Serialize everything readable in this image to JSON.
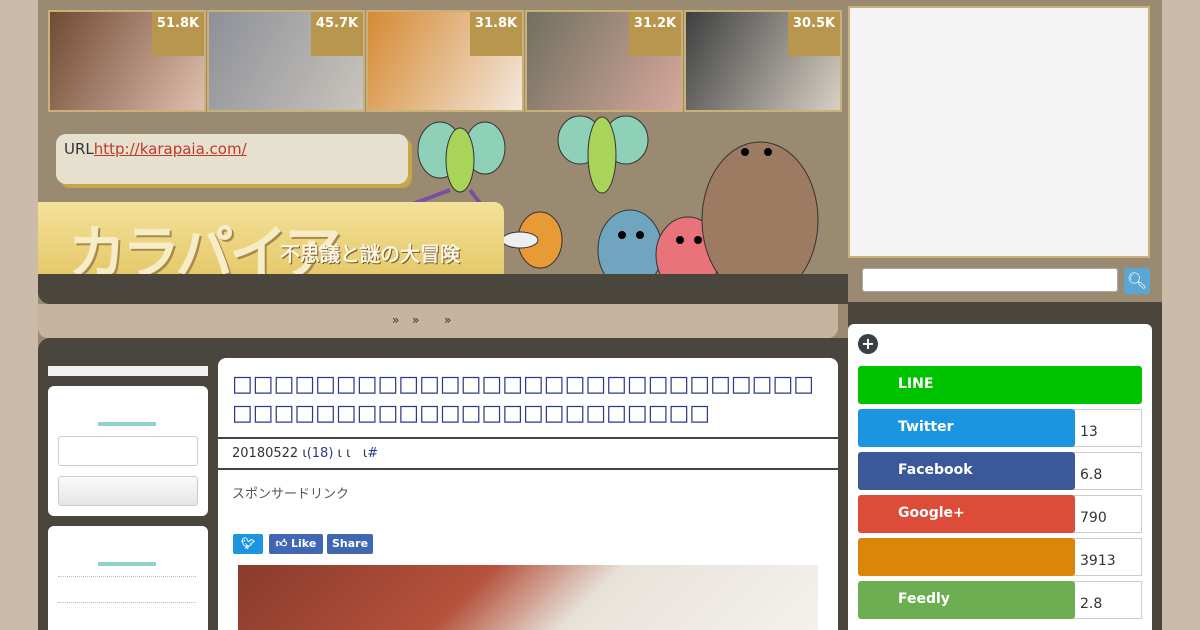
{
  "thumbnails": [
    {
      "count": "51.8K",
      "colors": [
        "#6f4a35",
        "#e0bfae"
      ]
    },
    {
      "count": "45.7K",
      "colors": [
        "#8d9098",
        "#c9c4bc"
      ]
    },
    {
      "count": "31.8K",
      "colors": [
        "#d58a32",
        "#f3e7dc"
      ]
    },
    {
      "count": "31.2K",
      "colors": [
        "#70705e",
        "#d6a89c"
      ]
    },
    {
      "count": "30.5K",
      "colors": [
        "#3d3f3f",
        "#d8d0c5"
      ]
    }
  ],
  "header": {
    "url_label": "URL",
    "url_link": "http://karapaia.com/",
    "logo": "カラパイア",
    "tagline": "不思議と謎の大冒険"
  },
  "breadcrumb": [
    "»",
    "»",
    "»"
  ],
  "article": {
    "title": "□□□□□□□□□□□□□□□□□□□□□□□□□□□□□□□□□□□□□□□□□□□□□□□□□□□",
    "date": "20180522",
    "sep1": "ι",
    "comments": "(18)",
    "sep2": "ι ι",
    "sep3": "ι",
    "hash": "#",
    "sponsor": "スポンサードリンク",
    "share_twitter": "",
    "share_like": "Like",
    "share_share": "Share"
  },
  "share_panel": {
    "rows": [
      {
        "label": "LINE",
        "count": "",
        "color": "#00c300"
      },
      {
        "label": "Twitter",
        "count": "13",
        "color": "#1b95e0"
      },
      {
        "label": "Facebook",
        "count": "6.8",
        "color": "#3b5998"
      },
      {
        "label": "Google+",
        "count": "790",
        "color": "#dd4b39"
      },
      {
        "label": "",
        "count": "3913",
        "color": "#d9860b"
      },
      {
        "label": "Feedly",
        "count": "2.8",
        "color": "#6cad52"
      }
    ]
  }
}
